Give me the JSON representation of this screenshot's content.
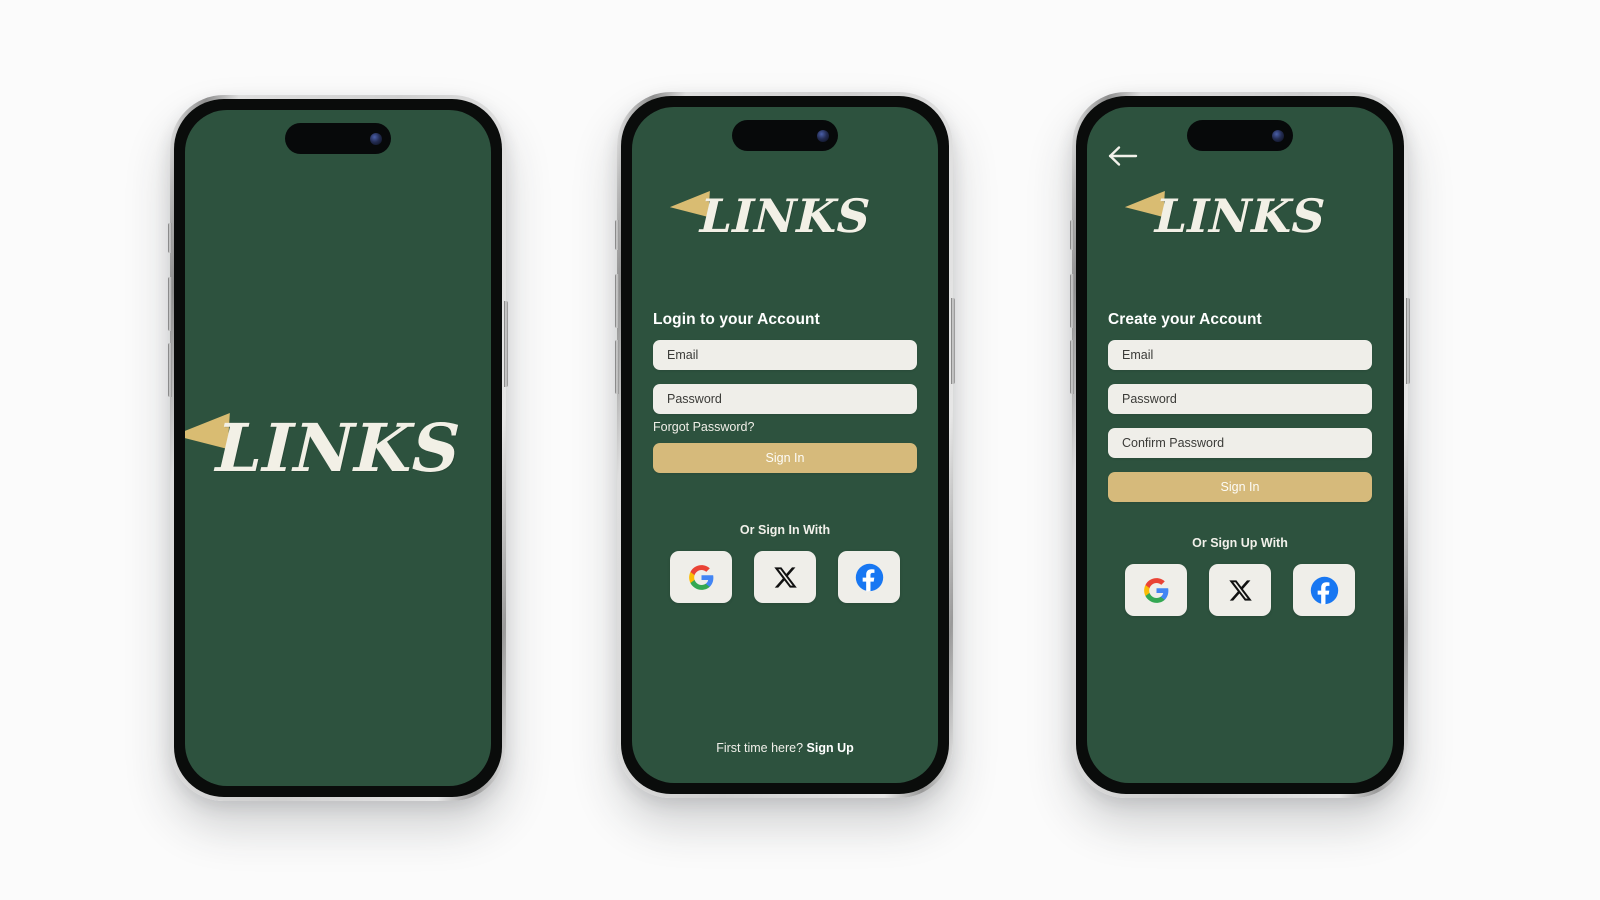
{
  "theme": {
    "page_background": "#fbfbfb",
    "screen_green": "#2d523e",
    "gold_accent": "#d6ba7b",
    "field_cream": "#efeee9",
    "logo_cream": "#f2f0e6",
    "flag_gold": "#d9bc72"
  },
  "brand": {
    "wordmark": "LINKS",
    "flag_icon": "pennant-flag-icon"
  },
  "screens": [
    {
      "id": "splash",
      "name": "splash-screen",
      "logo": "LINKS"
    },
    {
      "id": "login",
      "name": "login-screen",
      "logo": "LINKS",
      "heading": "Login to your Account",
      "fields": [
        {
          "name": "email-field",
          "placeholder": "Email",
          "value": ""
        },
        {
          "name": "password-field",
          "placeholder": "Password",
          "value": ""
        }
      ],
      "forgot_password": "Forgot Password?",
      "submit_label": "Sign In",
      "divider_label": "Or Sign In With",
      "social": [
        {
          "name": "google-signin-button",
          "icon": "google-icon",
          "label": "Google"
        },
        {
          "name": "x-signin-button",
          "icon": "x-twitter-icon",
          "label": "X"
        },
        {
          "name": "facebook-signin-button",
          "icon": "facebook-icon",
          "label": "Facebook"
        }
      ],
      "footer_prefix": "First time here?",
      "footer_link": "Sign Up"
    },
    {
      "id": "signup",
      "name": "signup-screen",
      "logo": "LINKS",
      "back_icon": "arrow-left-icon",
      "heading": "Create your Account",
      "fields": [
        {
          "name": "email-field",
          "placeholder": "Email",
          "value": ""
        },
        {
          "name": "password-field",
          "placeholder": "Password",
          "value": ""
        },
        {
          "name": "confirm-password-field",
          "placeholder": "Confirm Password",
          "value": ""
        }
      ],
      "submit_label": "Sign In",
      "divider_label": "Or Sign Up With",
      "social": [
        {
          "name": "google-signup-button",
          "icon": "google-icon",
          "label": "Google"
        },
        {
          "name": "x-signup-button",
          "icon": "x-twitter-icon",
          "label": "X"
        },
        {
          "name": "facebook-signup-button",
          "icon": "facebook-icon",
          "label": "Facebook"
        }
      ]
    }
  ]
}
